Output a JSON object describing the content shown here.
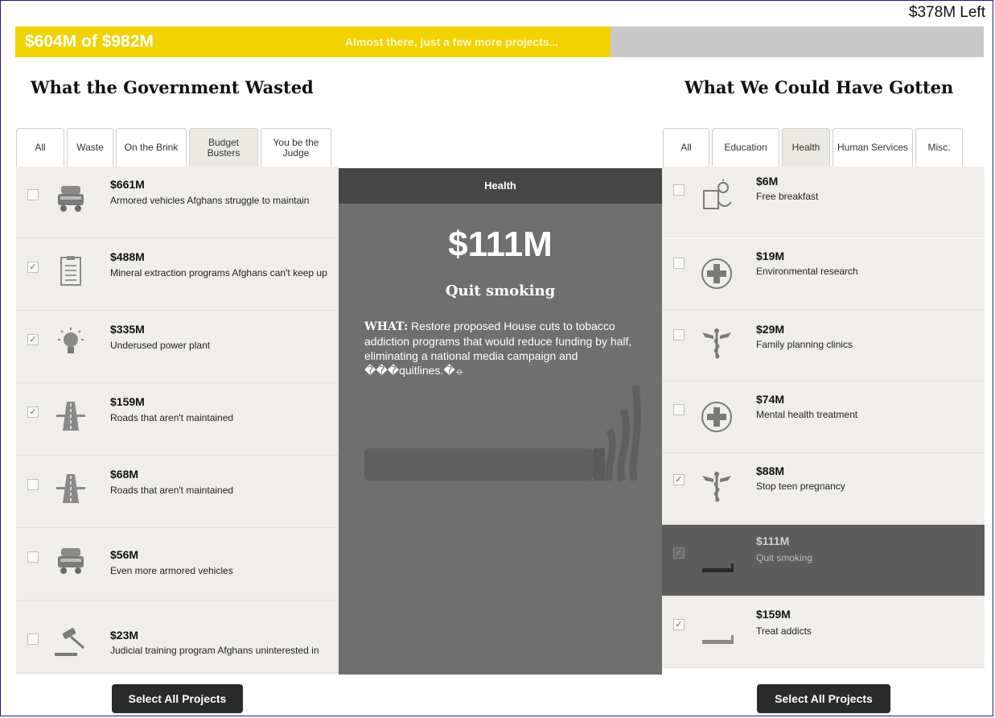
{
  "budget": {
    "remaining": "$378M Left",
    "progress_amount": "$604M of $982M",
    "progress_message": "Almost there, just a few more projects...",
    "progress_fraction": 0.615
  },
  "left_panel": {
    "heading": "What the Government Wasted",
    "tabs": [
      {
        "label": "All",
        "active": false
      },
      {
        "label": "Waste",
        "active": false
      },
      {
        "label": "On the Brink",
        "active": false
      },
      {
        "label": "Budget Busters",
        "active": true
      },
      {
        "label": "You be the Judge",
        "active": false
      }
    ],
    "items": [
      {
        "amount": "$661M",
        "desc": "Armored vehicles Afghans struggle to maintain",
        "checked": false,
        "icon": "armored-vehicle-icon"
      },
      {
        "amount": "$488M",
        "desc": "Mineral extraction programs Afghans can't keep up",
        "checked": true,
        "icon": "clipboard-icon"
      },
      {
        "amount": "$335M",
        "desc": "Underused power plant",
        "checked": true,
        "icon": "lightbulb-icon"
      },
      {
        "amount": "$159M",
        "desc": "Roads that aren't maintained",
        "checked": true,
        "icon": "road-icon"
      },
      {
        "amount": "$68M",
        "desc": "Roads that aren't maintained",
        "checked": false,
        "icon": "road-icon"
      },
      {
        "amount": "$56M",
        "desc": "Even more armored vehicles",
        "checked": false,
        "icon": "armored-vehicle-icon"
      },
      {
        "amount": "$23M",
        "desc": "Judicial training program Afghans uninterested in",
        "checked": false,
        "icon": "gavel-icon"
      }
    ],
    "button": "Select All Projects"
  },
  "detail": {
    "category": "Health",
    "amount": "$111M",
    "title": "Quit smoking",
    "what_label": "WHAT:",
    "what_text": "Restore proposed House cuts to tobacco addiction programs that would reduce funding by half, eliminating a national media campaign and ���quitlines.�⦵"
  },
  "right_panel": {
    "heading": "What We Could Have Gotten",
    "tabs": [
      {
        "label": "All",
        "active": false
      },
      {
        "label": "Education",
        "active": false
      },
      {
        "label": "Health",
        "active": true
      },
      {
        "label": "Human Services",
        "active": false
      },
      {
        "label": "Misc.",
        "active": false
      }
    ],
    "items": [
      {
        "amount": "$6M",
        "desc": "Free breakfast",
        "checked": false,
        "selected": false,
        "icon": "breakfast-icon"
      },
      {
        "amount": "$19M",
        "desc": "Environmental research",
        "checked": false,
        "selected": false,
        "icon": "medical-cross-icon"
      },
      {
        "amount": "$29M",
        "desc": "Family planning clinics",
        "checked": false,
        "selected": false,
        "icon": "caduceus-icon"
      },
      {
        "amount": "$74M",
        "desc": "Mental health treatment",
        "checked": false,
        "selected": false,
        "icon": "medical-cross-icon"
      },
      {
        "amount": "$88M",
        "desc": "Stop teen pregnancy",
        "checked": true,
        "selected": false,
        "icon": "caduceus-icon"
      },
      {
        "amount": "$111M",
        "desc": "Quit smoking",
        "checked": true,
        "selected": true,
        "icon": "cigarette-icon"
      },
      {
        "amount": "$159M",
        "desc": "Treat addicts",
        "checked": true,
        "selected": false,
        "icon": "cigarette-icon"
      }
    ],
    "button": "Select All Projects"
  }
}
